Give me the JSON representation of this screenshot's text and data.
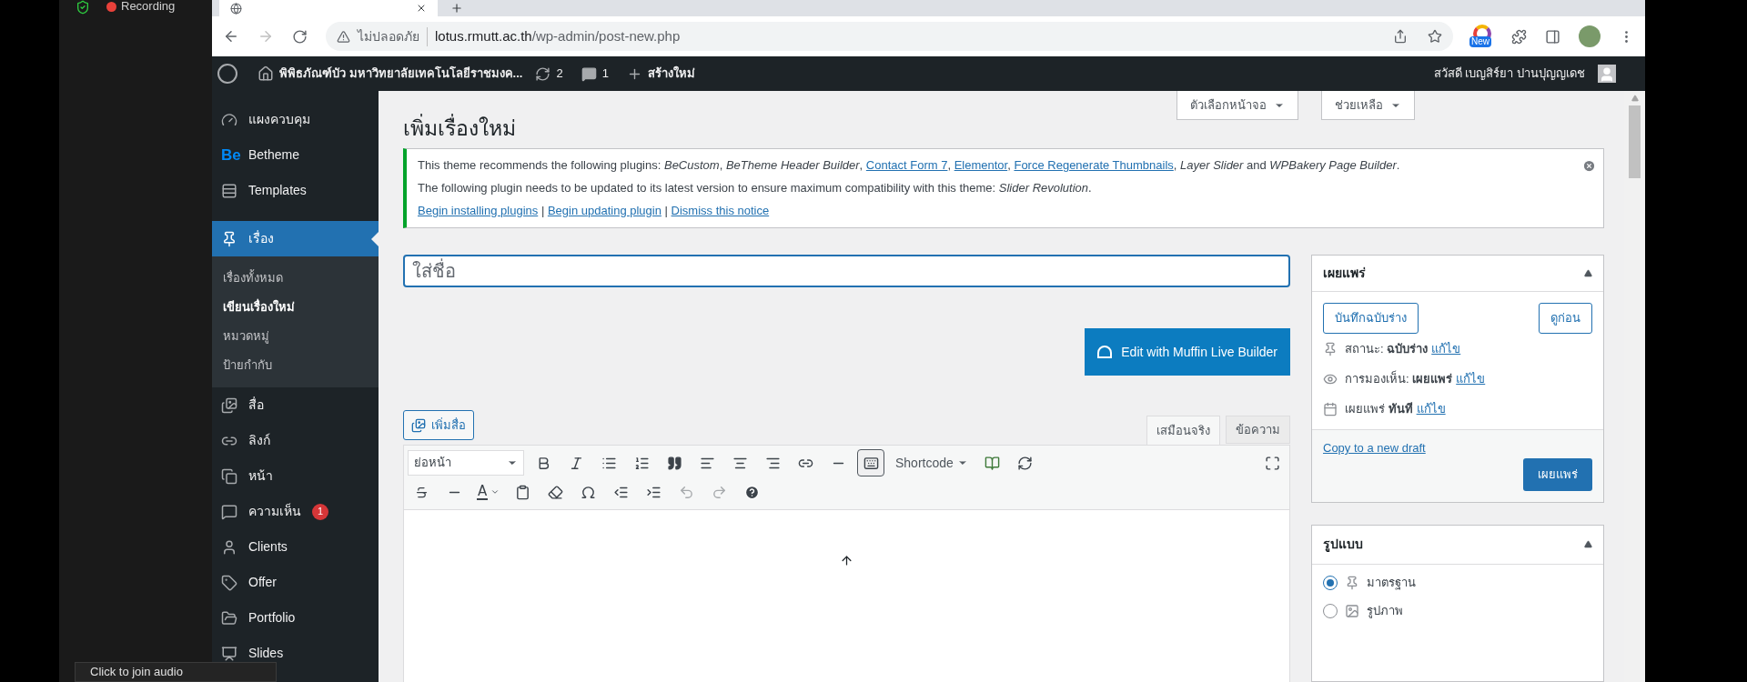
{
  "recorder": {
    "label": "Recording"
  },
  "browser": {
    "security": "ไม่ปลอดภัย",
    "url_host": "lotus.rmutt.ac.th",
    "url_path": "/wp-admin/post-new.php",
    "extension_badge": "New"
  },
  "admin_bar": {
    "site_name": "พิพิธภัณฑ์บัว มหาวิทยาลัยเทคโนโลยีราชมงค...",
    "updates": "2",
    "comments": "1",
    "new": "สร้างใหม่",
    "greeting": "สวัสดี เบญสิร์ยา ปานปุญญเดช"
  },
  "sidebar": {
    "items": [
      {
        "label": "แผงควบคุม",
        "selected": false
      },
      {
        "label": "Betheme",
        "icon_text": "Be",
        "selected": false
      },
      {
        "label": "Templates",
        "selected": false
      },
      {
        "label": "เรื่อง",
        "selected": true,
        "children": [
          {
            "label": "เรื่องทั้งหมด",
            "selected": false
          },
          {
            "label": "เขียนเรื่องใหม่",
            "selected": true
          },
          {
            "label": "หมวดหมู่",
            "selected": false
          },
          {
            "label": "ป้ายกำกับ",
            "selected": false
          }
        ]
      },
      {
        "label": "สื่อ",
        "selected": false
      },
      {
        "label": "ลิงก์",
        "selected": false
      },
      {
        "label": "หน้า",
        "selected": false
      },
      {
        "label": "ความเห็น",
        "badge": "1",
        "selected": false
      },
      {
        "label": "Clients",
        "selected": false
      },
      {
        "label": "Offer",
        "selected": false
      },
      {
        "label": "Portfolio",
        "selected": false
      },
      {
        "label": "Slides",
        "selected": false
      }
    ]
  },
  "screen_buttons": [
    "ตัวเลือกหน้าจอ",
    "ช่วยเหลือ"
  ],
  "page_title": "เพิ่มเรื่องใหม่",
  "notice": {
    "lines": [
      [
        {
          "kind": "text",
          "text": "This theme recommends the following plugins: *BeCustom*, *BeTheme Header Builder*, "
        },
        {
          "kind": "link",
          "text": "Contact Form 7"
        },
        {
          "kind": "text",
          "text": ", "
        },
        {
          "kind": "link",
          "text": "Elementor"
        },
        {
          "kind": "text",
          "text": ", "
        },
        {
          "kind": "link",
          "text": "Force Regenerate Thumbnails"
        },
        {
          "kind": "text",
          "text": ", *Layer Slider* and *WPBakery Page Builder*."
        }
      ],
      [
        {
          "kind": "text",
          "text": "The following plugin needs to be updated to its latest version to ensure maximum compatibility with this theme: *Slider Revolution*."
        }
      ],
      [
        {
          "kind": "link",
          "text": "Begin installing plugins"
        },
        {
          "kind": "text",
          "text": " | "
        },
        {
          "kind": "link",
          "text": "Begin updating plugin"
        },
        {
          "kind": "text",
          "text": " | "
        },
        {
          "kind": "link",
          "text": "Dismiss this notice"
        }
      ]
    ]
  },
  "title_field": {
    "placeholder": "ใส่ชื่อ"
  },
  "muffin_button": "Edit with Muffin Live Builder",
  "add_media": "เพิ่มสื่อ",
  "editor_tabs": [
    {
      "label": "เสมือนจริง",
      "selected": true
    },
    {
      "label": "ข้อความ",
      "selected": false
    }
  ],
  "editor": {
    "format": "ย่อหน้า",
    "text_color_label": "A",
    "shortcode": "Shortcode",
    "toolbar_toggle_pressed": true,
    "undo_disabled": true,
    "redo_disabled": true
  },
  "publish_box": {
    "title": "เผยแพร่",
    "save_draft": "บันทึกฉบับร่าง",
    "preview": "ดูก่อน",
    "rows": [
      {
        "text": "สถานะ: **ฉบับร่าง**",
        "link": "แก้ไข"
      },
      {
        "text": "การมองเห็น: **เผยแพร่**",
        "link": "แก้ไข"
      },
      {
        "text": "เผยแพร่ **ทันที**",
        "link": "แก้ไข"
      }
    ],
    "copy_link": "Copy to a new draft",
    "publish": "เผยแพร่"
  },
  "format_box": {
    "title": "รูปแบบ",
    "options": [
      {
        "label": "มาตรฐาน",
        "selected": true
      },
      {
        "label": "รูปภาพ",
        "selected": false
      }
    ]
  },
  "audio_tooltip": "Click to join audio"
}
